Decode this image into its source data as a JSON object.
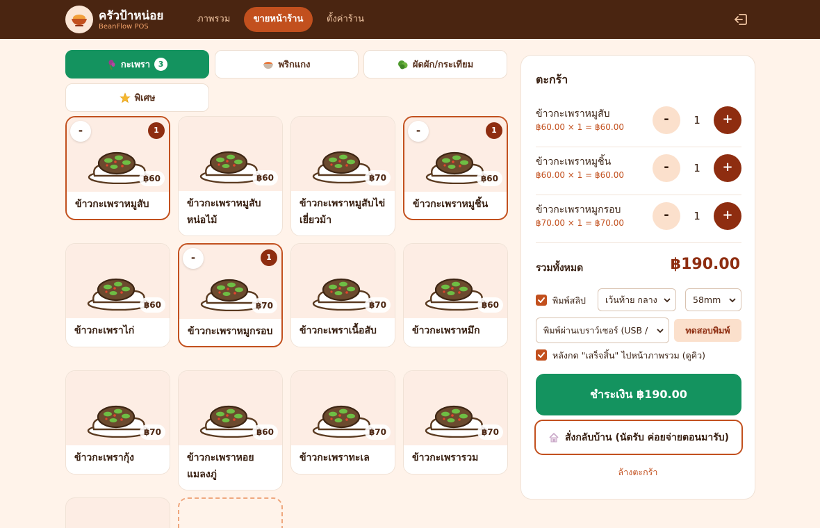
{
  "header": {
    "brand_name": "ครัวป้าหน่อย",
    "brand_sub": "BeanFlow POS",
    "nav": [
      "ภาพรวม",
      "ขายหน้าร้าน",
      "ตั้งค่าร้าน"
    ],
    "active_nav": "ขายหน้าร้าน",
    "logout_icon": "logout-icon"
  },
  "categories": [
    {
      "label": "กะเพรา",
      "icon": "basil-icon",
      "badge": "3",
      "active": true
    },
    {
      "label": "พริกแกง",
      "icon": "curry-bowl-icon"
    },
    {
      "label": "ผัดผัก/กระเทียม",
      "icon": "vegetable-icon"
    },
    {
      "label": "พิเศษ",
      "icon": "star-icon"
    }
  ],
  "products": [
    {
      "name": "ข้าวกะเพราหมูสับ",
      "price": "฿60",
      "selected": true,
      "qty": "1",
      "minus": "-"
    },
    {
      "name": "ข้าวกะเพราหมูสับหน่อไม้",
      "price": "฿60"
    },
    {
      "name": "ข้าวกะเพราหมูสับไข่เยี่ยวม้า",
      "price": "฿70"
    },
    {
      "name": "ข้าวกะเพราหมูชิ้น",
      "price": "฿60",
      "selected": true,
      "qty": "1",
      "minus": "-"
    },
    {
      "name": "ข้าวกะเพราไก่",
      "price": "฿60"
    },
    {
      "name": "ข้าวกะเพราหมูกรอบ",
      "price": "฿70",
      "selected": true,
      "qty": "1",
      "minus": "-"
    },
    {
      "name": "ข้าวกะเพราเนื้อสับ",
      "price": "฿70"
    },
    {
      "name": "ข้าวกะเพราหมึก",
      "price": "฿60"
    },
    {
      "name": "ข้าวกะเพรากุ้ง",
      "price": "฿70"
    },
    {
      "name": "ข้าวกะเพราหอยแมลงภู่",
      "price": "฿60"
    },
    {
      "name": "ข้าวกะเพราทะเล",
      "price": "฿70"
    },
    {
      "name": "ข้าวกะเพรารวม",
      "price": "฿70"
    }
  ],
  "cart": {
    "title": "ตะกร้า",
    "items": [
      {
        "name": "ข้าวกะเพราหมูสับ",
        "detail": "฿60.00 × 1 = ฿60.00",
        "qty": "1",
        "dec": "-",
        "inc": "+"
      },
      {
        "name": "ข้าวกะเพราหมูชิ้น",
        "detail": "฿60.00 × 1 = ฿60.00",
        "qty": "1",
        "dec": "-",
        "inc": "+"
      },
      {
        "name": "ข้าวกะเพราหมูกรอบ",
        "detail": "฿70.00 × 1 = ฿70.00",
        "qty": "1",
        "dec": "-",
        "inc": "+"
      }
    ],
    "total_label": "รวมทั้งหมด",
    "total_value": "฿190.00",
    "print_slip_label": "พิมพ์สลิป",
    "print_slip_checked": true,
    "margin_select": "เว้นท้าย กลาง",
    "paper_select": "58mm",
    "printer_select": "พิมพ์ผ่านเบราว์เซอร์ (USB /",
    "test_print_label": "ทดสอบพิมพ์",
    "after_finish_label": "หลังกด \"เสร็จสิ้น\" ไปหน้าภาพรวม (ดูคิว)",
    "after_finish_checked": true,
    "pay_label": "ชำระเงิน ฿190.00",
    "home_order_label": "สั่งกลับบ้าน (นัดรับ ค่อยจ่ายตอนมารับ)",
    "home_order_icon": "house-icon",
    "clear_label": "ล้างตะกร้า"
  },
  "colors": {
    "header_bg": "#4A2511",
    "accent": "#C2501E",
    "green": "#14935F",
    "dark_brown": "#8E2D10",
    "page_bg": "#FFF3EA"
  }
}
